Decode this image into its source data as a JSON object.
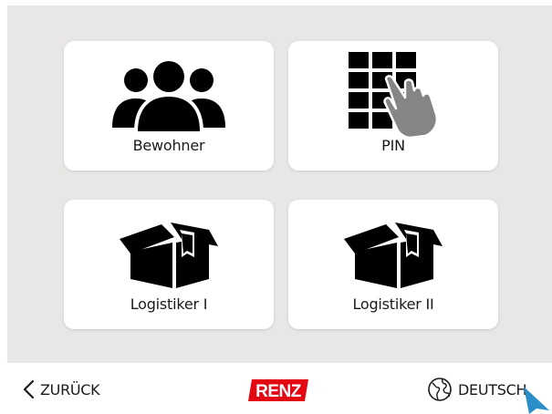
{
  "tiles": [
    {
      "label": "Bewohner",
      "icon": "residents-icon"
    },
    {
      "label": "PIN",
      "icon": "keypad-touch-icon"
    },
    {
      "label": "Logistiker I",
      "icon": "package-icon"
    },
    {
      "label": "Logistiker II",
      "icon": "package-icon"
    }
  ],
  "footer": {
    "back_label": "ZURÜCK",
    "logo_text": "RENZ",
    "language_label": "DEUTSCH"
  },
  "colors": {
    "background": "#e8e7e5",
    "tile": "#ffffff",
    "icon": "#000000",
    "logo_red": "#e30613",
    "cursor": "#2a8fc9"
  }
}
